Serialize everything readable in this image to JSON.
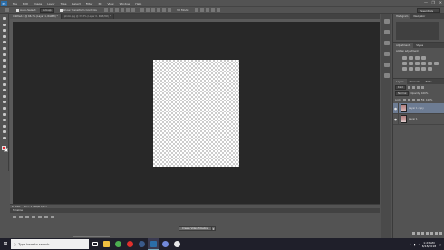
{
  "app": {
    "logo": "Ps",
    "menu": [
      "File",
      "Edit",
      "Image",
      "Layer",
      "Type",
      "Select",
      "Filter",
      "3D",
      "View",
      "Window",
      "Help"
    ],
    "window_controls": [
      "—",
      "❐",
      "✕"
    ]
  },
  "options_bar": {
    "auto_select_label": "Auto-Select:",
    "auto_select_value": "Group",
    "transform_label": "Show Transform Controls",
    "mode_label": "3D Mode:",
    "workspace": "Essentials"
  },
  "document_tabs": [
    {
      "label": "Untitled-1 @ 66.7% (Layer 1, RGB/8) *",
      "active": true
    },
    {
      "label": "photo.jpg @ 33.3% (Layer 0, RGB/8#) *",
      "active": false
    }
  ],
  "status_bar": {
    "zoom": "66.67%",
    "doc_info": "Doc: 2.37M/0 bytes"
  },
  "timeline": {
    "tab_label": "Timeline",
    "create_button": "Create Video Timeline",
    "caret": "▾"
  },
  "panels": {
    "history_tabs": [
      "Histogram",
      "Navigator"
    ],
    "adjustments_tabs": [
      "Adjustments",
      "Styles"
    ],
    "adjustments_title": "Add an adjustment",
    "layers_tabs": [
      "Layers",
      "Channels",
      "Paths"
    ],
    "kind_label": "Kind",
    "blend_mode": "Normal",
    "opacity_label": "Opacity: 100%",
    "lock_label": "Lock:",
    "fill_label": "Fill: 100%",
    "layers": [
      {
        "name": "Layer 1 copy",
        "selected": true
      },
      {
        "name": "Layer 1",
        "selected": false
      }
    ]
  },
  "taskbar": {
    "start_icon": "⊞",
    "search_placeholder": "Type here to search",
    "search_icon": "search-icon",
    "apps": [
      {
        "name": "task-view-icon",
        "color": "#ffffff"
      },
      {
        "name": "file-explorer-icon",
        "color": "#f0c040"
      },
      {
        "name": "chrome-icon",
        "color": "#4caf50"
      },
      {
        "name": "opera-icon",
        "color": "#e0302c"
      },
      {
        "name": "steam-icon",
        "color": "#3a5a8a"
      },
      {
        "name": "photoshop-icon",
        "color": "#2b6ea8"
      },
      {
        "name": "discord-icon",
        "color": "#7289da"
      },
      {
        "name": "media-icon",
        "color": "#e8e8e8"
      }
    ],
    "time": "1:23 AM",
    "date": "6/18/2018"
  },
  "colors": {
    "foreground": "#e8262f",
    "background": "#ffffff",
    "selection": "#6d7c93"
  }
}
